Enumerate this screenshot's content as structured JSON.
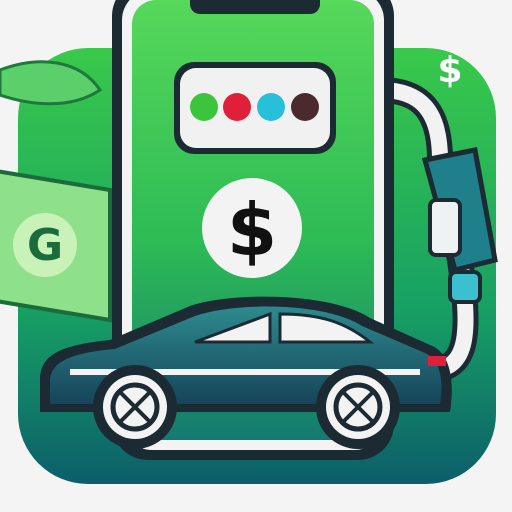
{
  "icon": {
    "main_symbol": "$",
    "corner_symbol": "$",
    "banknote_letter": "G"
  },
  "colors": {
    "background": "#f4f4f4",
    "tile_green": "#2fbf4a",
    "tile_teal": "#0f6f6a",
    "phone_green": "#3ccf55",
    "car_teal": "#1f6b78",
    "outline": "#1c2a33",
    "dot_green": "#3cc53c",
    "dot_red": "#e0203a",
    "dot_cyan": "#28c0d8",
    "dot_brown": "#4a2a2e"
  }
}
